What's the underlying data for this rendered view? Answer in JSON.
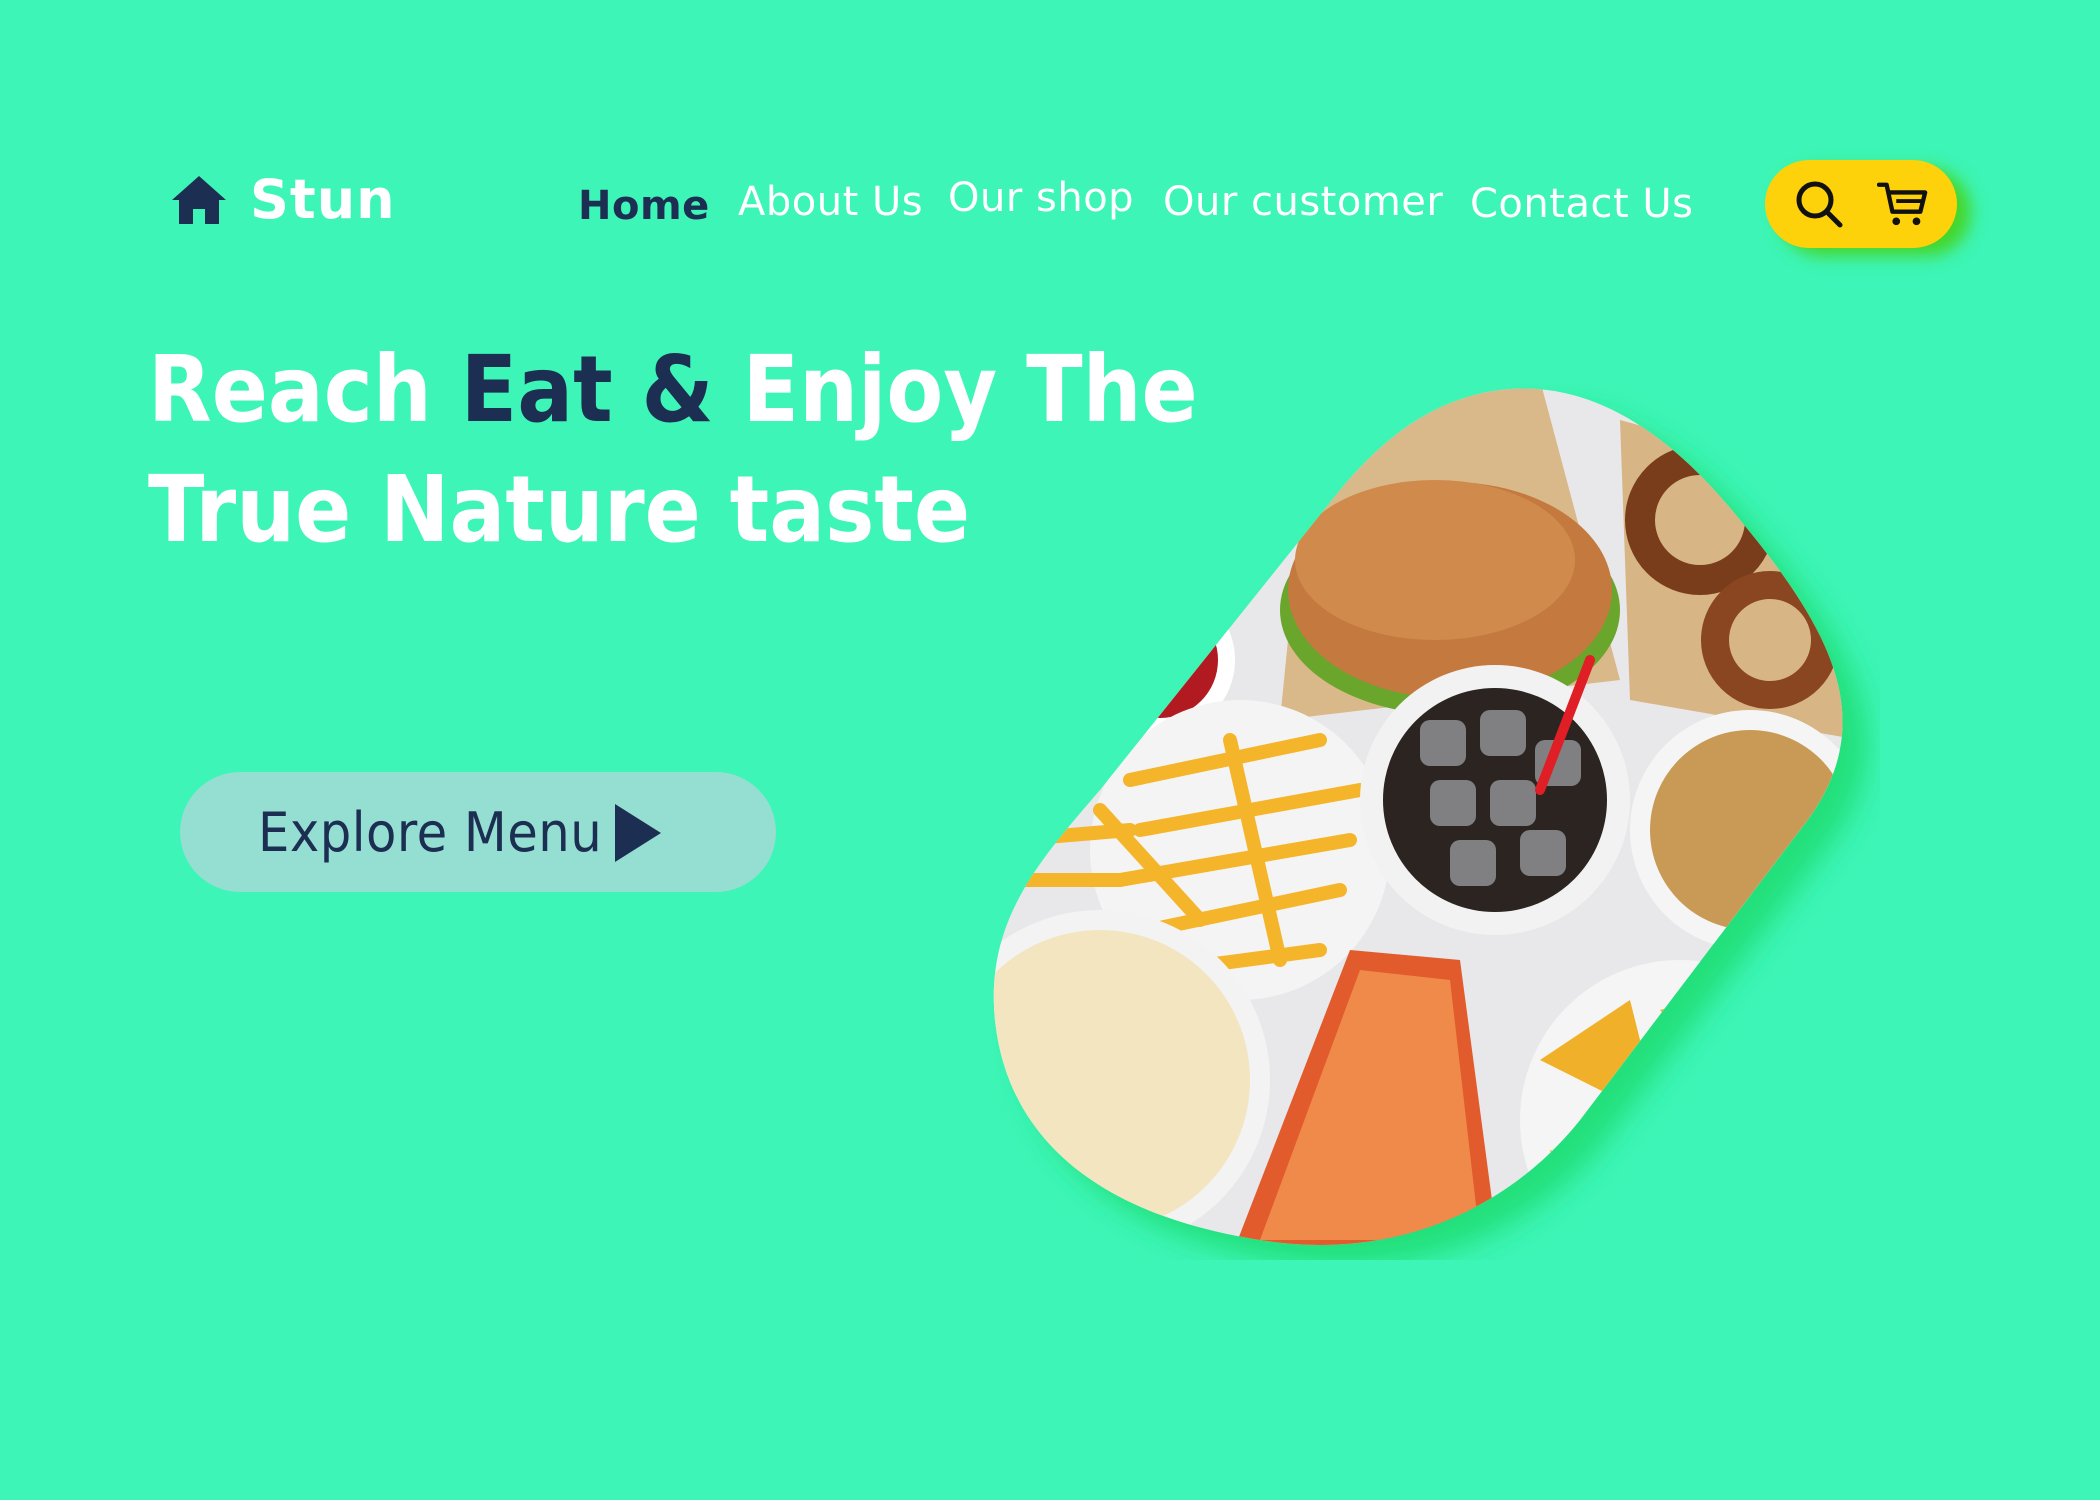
{
  "brand": {
    "name": "Stun",
    "icon": "home-icon"
  },
  "nav": {
    "items": [
      {
        "label": "Home",
        "active": true
      },
      {
        "label": "About Us",
        "active": false
      },
      {
        "label": "Our shop",
        "active": false
      },
      {
        "label": "Our customer",
        "active": false
      },
      {
        "label": "Contact Us",
        "active": false
      }
    ]
  },
  "actions": {
    "search_icon": "search-icon",
    "cart_icon": "cart-icon"
  },
  "hero": {
    "headline_part1": "Reach ",
    "headline_accent": "Eat & ",
    "headline_part2": "Enjoy The",
    "headline_line2": "True Nature taste",
    "cta_label": "Explore Menu",
    "cta_icon": "play-icon"
  },
  "colors": {
    "background": "#3df5b6",
    "navy": "#1c2f52",
    "accent_yellow": "#fdd20a",
    "button_bg": "#95dfd2"
  }
}
